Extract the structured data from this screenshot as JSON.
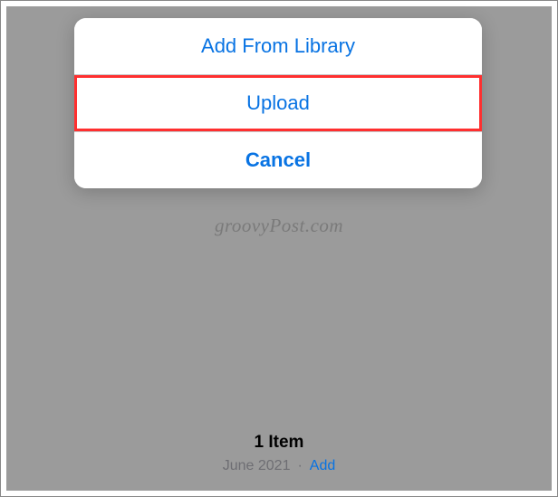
{
  "actionSheet": {
    "addFromLibrary": "Add From Library",
    "upload": "Upload",
    "cancel": "Cancel"
  },
  "watermark": "groovyPost.com",
  "footer": {
    "itemCount": "1 Item",
    "date": "June 2021",
    "addLabel": "Add"
  }
}
